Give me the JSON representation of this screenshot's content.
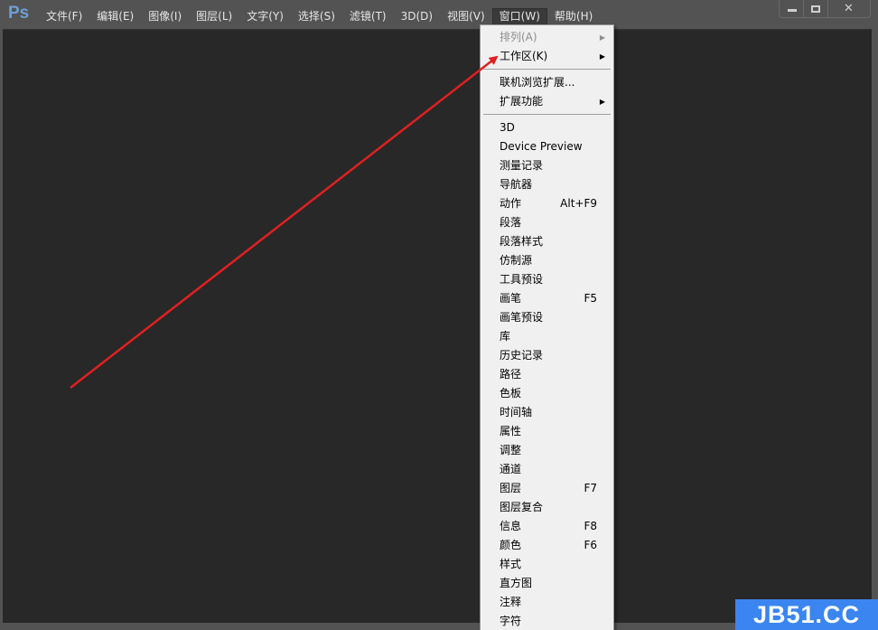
{
  "app": {
    "logo": "Ps"
  },
  "menubar": {
    "items": [
      {
        "label": "文件(F)"
      },
      {
        "label": "编辑(E)"
      },
      {
        "label": "图像(I)"
      },
      {
        "label": "图层(L)"
      },
      {
        "label": "文字(Y)"
      },
      {
        "label": "选择(S)"
      },
      {
        "label": "滤镜(T)"
      },
      {
        "label": "3D(D)"
      },
      {
        "label": "视图(V)"
      },
      {
        "label": "窗口(W)",
        "active": true
      },
      {
        "label": "帮助(H)"
      }
    ]
  },
  "window_controls": {
    "minimize": "minimize-icon",
    "maximize": "maximize-icon",
    "close": "close-icon",
    "close_glyph": "✕"
  },
  "window_menu": {
    "groups": [
      [
        {
          "label": "排列(A)",
          "disabled": true,
          "submenu": true
        },
        {
          "label": "工作区(K)",
          "submenu": true
        }
      ],
      [
        {
          "label": "联机浏览扩展..."
        },
        {
          "label": "扩展功能",
          "submenu": true
        }
      ],
      [
        {
          "label": "3D"
        },
        {
          "label": "Device Preview"
        },
        {
          "label": "测量记录"
        },
        {
          "label": "导航器"
        },
        {
          "label": "动作",
          "shortcut": "Alt+F9"
        },
        {
          "label": "段落"
        },
        {
          "label": "段落样式"
        },
        {
          "label": "仿制源"
        },
        {
          "label": "工具预设"
        },
        {
          "label": "画笔",
          "shortcut": "F5"
        },
        {
          "label": "画笔预设"
        },
        {
          "label": "库"
        },
        {
          "label": "历史记录"
        },
        {
          "label": "路径"
        },
        {
          "label": "色板"
        },
        {
          "label": "时间轴"
        },
        {
          "label": "属性"
        },
        {
          "label": "调整"
        },
        {
          "label": "通道"
        },
        {
          "label": "图层",
          "shortcut": "F7"
        },
        {
          "label": "图层复合"
        },
        {
          "label": "信息",
          "shortcut": "F8"
        },
        {
          "label": "颜色",
          "shortcut": "F6"
        },
        {
          "label": "样式"
        },
        {
          "label": "直方图"
        },
        {
          "label": "注释"
        },
        {
          "label": "字符"
        }
      ]
    ],
    "submenu_glyph": "▶"
  },
  "annotation": {
    "arrow_color": "#e02020",
    "points_to": "工作区(K)"
  },
  "watermark": {
    "text": "JB51.CC",
    "color": "#3a85f0"
  }
}
